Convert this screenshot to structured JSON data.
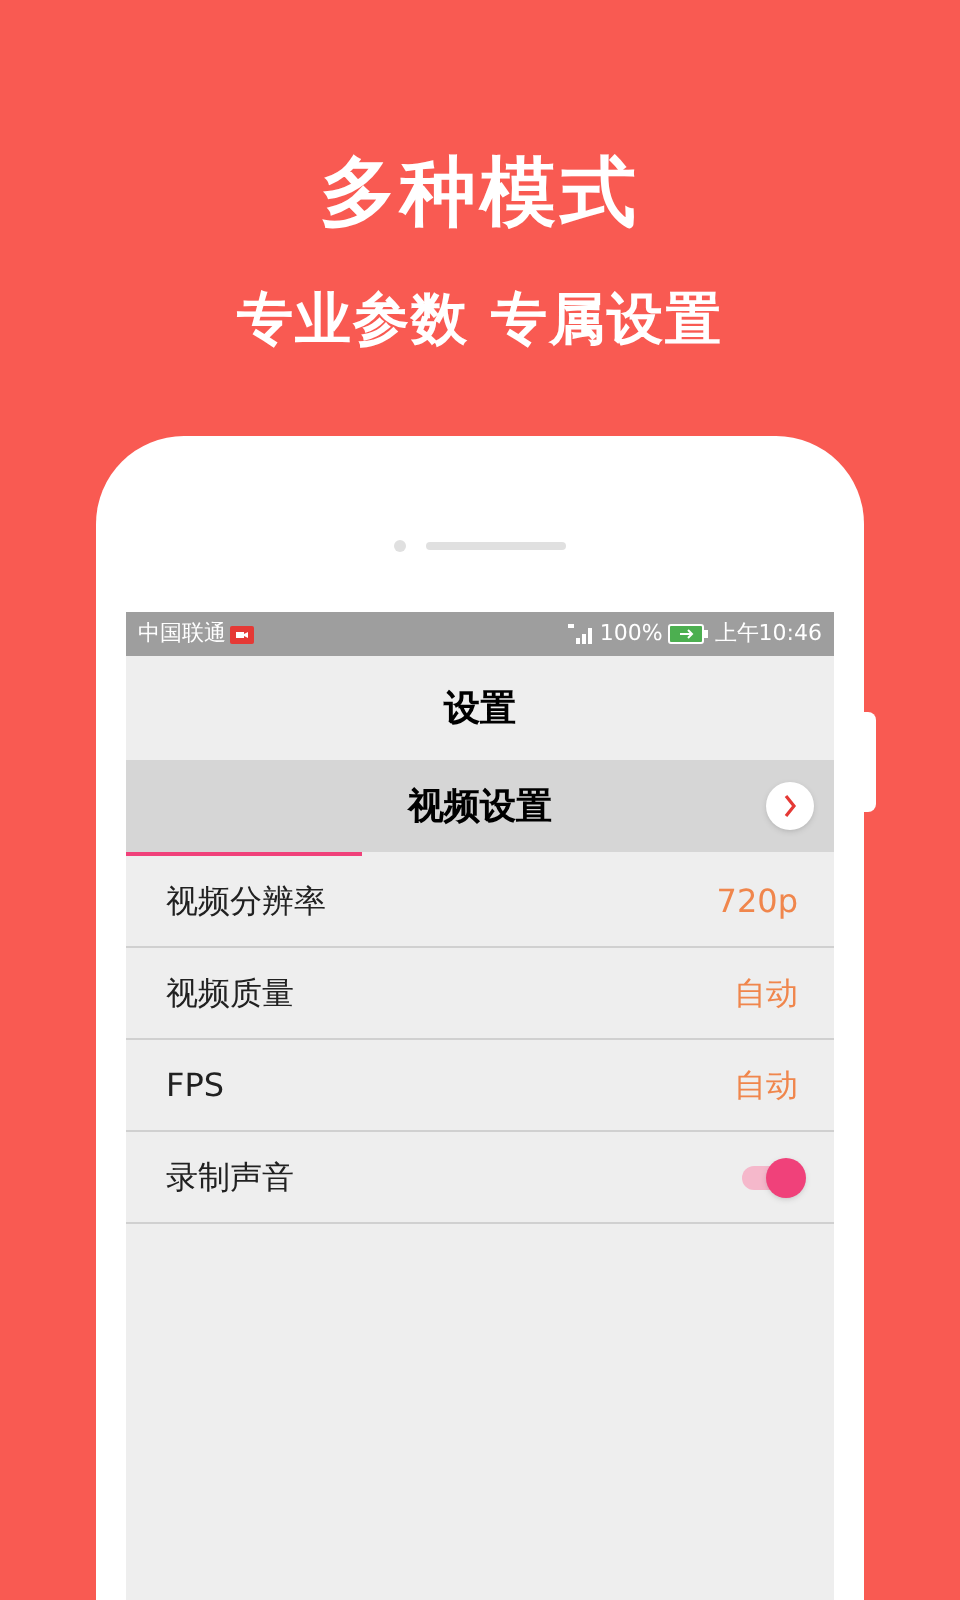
{
  "headline": "多种模式",
  "subheadline": "专业参数 专属设置",
  "status_bar": {
    "carrier": "中国联通",
    "battery": "100%",
    "time": "上午10:46"
  },
  "title": "设置",
  "tab": {
    "label": "视频设置",
    "selected": true
  },
  "rows": [
    {
      "kind": "value",
      "label": "视频分辨率",
      "value": "720p"
    },
    {
      "kind": "value",
      "label": "视频质量",
      "value": "自动"
    },
    {
      "kind": "value",
      "label": "FPS",
      "value": "自动"
    },
    {
      "kind": "toggle",
      "label": "录制声音",
      "on": true
    }
  ]
}
